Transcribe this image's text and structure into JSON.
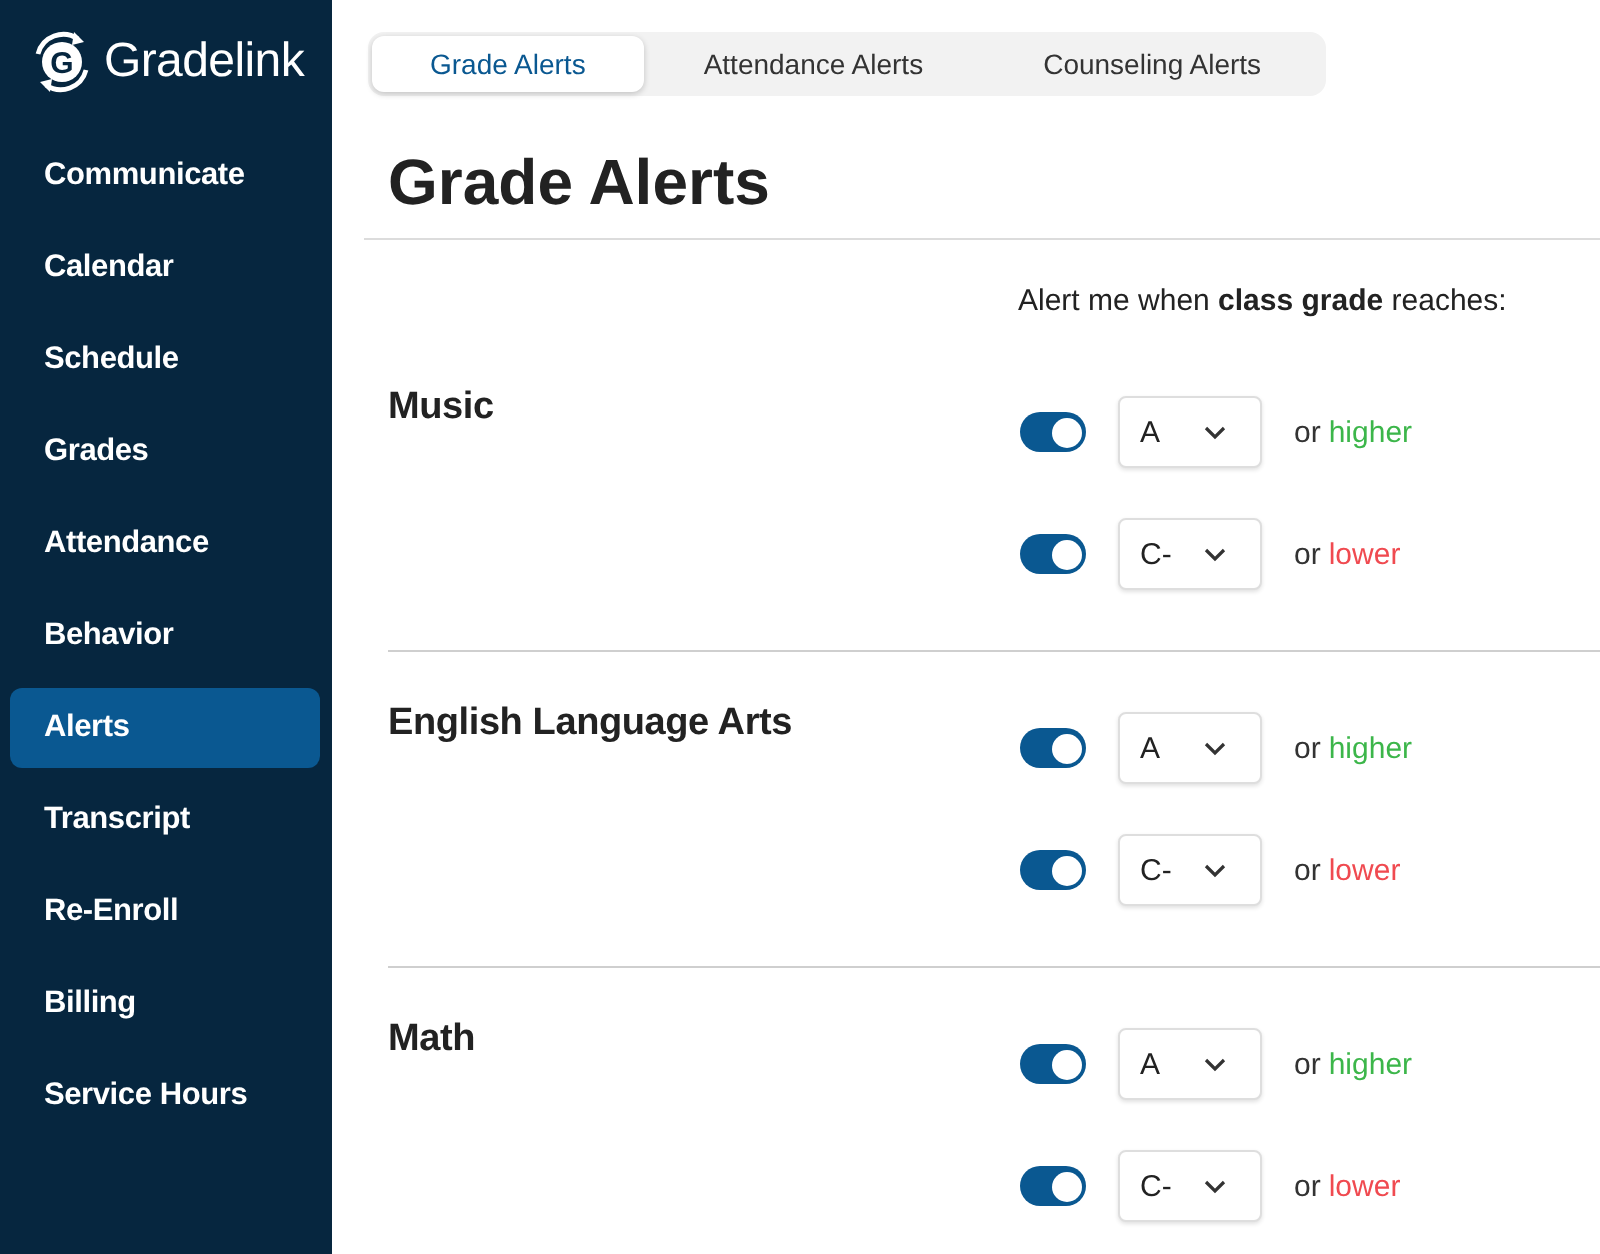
{
  "brand": {
    "mark": "G",
    "name": "Gradelink"
  },
  "sidebar": {
    "items": [
      {
        "label": "Communicate",
        "selected": false
      },
      {
        "label": "Calendar",
        "selected": false
      },
      {
        "label": "Schedule",
        "selected": false
      },
      {
        "label": "Grades",
        "selected": false
      },
      {
        "label": "Attendance",
        "selected": false
      },
      {
        "label": "Behavior",
        "selected": false
      },
      {
        "label": "Alerts",
        "selected": true
      },
      {
        "label": "Transcript",
        "selected": false
      },
      {
        "label": "Re-Enroll",
        "selected": false
      },
      {
        "label": "Billing",
        "selected": false
      },
      {
        "label": "Service Hours",
        "selected": false
      }
    ]
  },
  "tabs": [
    {
      "label": "Grade Alerts",
      "selected": true
    },
    {
      "label": "Attendance Alerts",
      "selected": false
    },
    {
      "label": "Counseling Alerts",
      "selected": false
    }
  ],
  "page": {
    "title": "Grade Alerts",
    "instruction": "Alert me when **class grade** reaches:"
  },
  "sections": [
    {
      "name": "Music",
      "rules": [
        {
          "on": true,
          "grade": "A",
          "conjunction": "or",
          "direction": "higher",
          "color": "#3cb64a"
        },
        {
          "on": true,
          "grade": "C-",
          "conjunction": "or",
          "direction": "lower",
          "color": "#f04a50"
        }
      ]
    },
    {
      "name": "English Language Arts",
      "rules": [
        {
          "on": true,
          "grade": "A",
          "conjunction": "or",
          "direction": "higher",
          "color": "#3cb64a"
        },
        {
          "on": true,
          "grade": "C-",
          "conjunction": "or",
          "direction": "lower",
          "color": "#f04a50"
        }
      ]
    },
    {
      "name": "Math",
      "rules": [
        {
          "on": true,
          "grade": "A",
          "conjunction": "or",
          "direction": "higher",
          "color": "#3cb64a"
        },
        {
          "on": true,
          "grade": "C-",
          "conjunction": "or",
          "direction": "lower",
          "color": "#f04a50"
        }
      ]
    }
  ]
}
